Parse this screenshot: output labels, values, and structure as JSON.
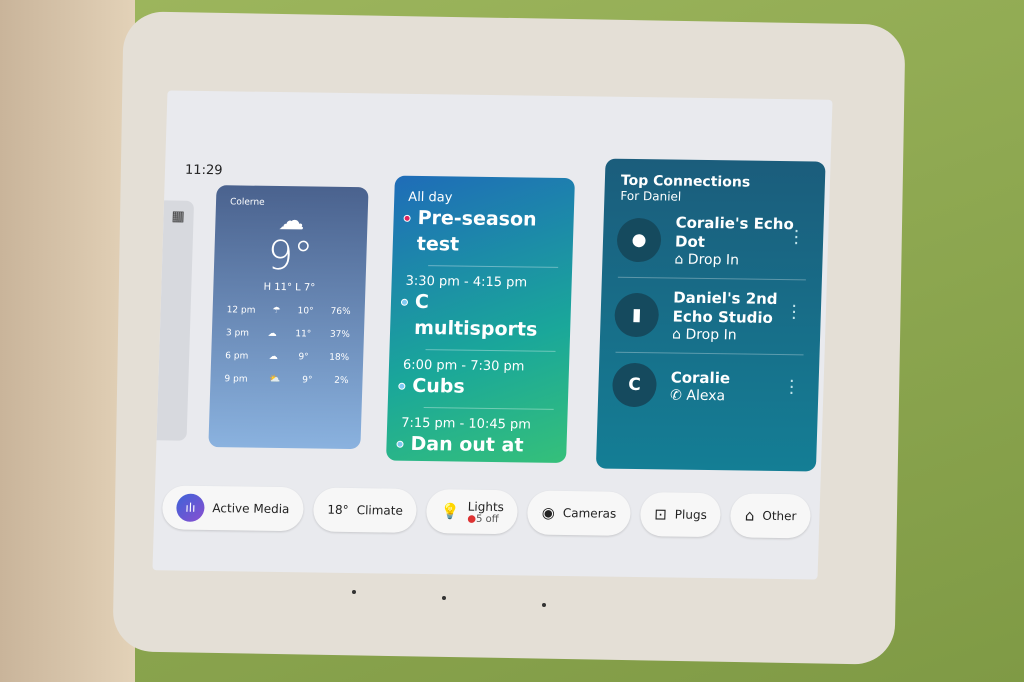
{
  "status": {
    "time": "11:29"
  },
  "weather": {
    "location": "Colerne",
    "temp": "9°",
    "high_low": "H 11°  L 7°",
    "hourly": [
      {
        "time": "12 pm",
        "icon": "rain-icon",
        "temp": "10°",
        "precip": "76%"
      },
      {
        "time": "3 pm",
        "icon": "cloud-icon",
        "temp": "11°",
        "precip": "37%"
      },
      {
        "time": "6 pm",
        "icon": "cloud-icon",
        "temp": "9°",
        "precip": "18%"
      },
      {
        "time": "9 pm",
        "icon": "partly-cloudy-icon",
        "temp": "9°",
        "precip": "2%"
      }
    ]
  },
  "calendar": {
    "events": [
      {
        "time": "All day",
        "title": "Pre-season test",
        "color": "#e0245e"
      },
      {
        "time": "3:30 pm - 4:15 pm",
        "title": "C multisports",
        "color": "#7ec8f0"
      },
      {
        "time": "6:00 pm - 7:30 pm",
        "title": "Cubs",
        "color": "#7ec8f0"
      },
      {
        "time": "7:15 pm - 10:45 pm",
        "title": "Dan out at dinner in Bath",
        "color": "#7ec8f0"
      }
    ]
  },
  "connections": {
    "title": "Top Connections",
    "subtitle": "For Daniel",
    "items": [
      {
        "avatar": "●",
        "name": "Coralie's Echo Dot",
        "action": "Drop In"
      },
      {
        "avatar": "▮",
        "name": "Daniel's 2nd Echo Studio",
        "action": "Drop In"
      },
      {
        "avatar": "C",
        "name": "Coralie",
        "action": "Alexa"
      }
    ]
  },
  "shortcuts": [
    {
      "label": "Active Media",
      "icon": "media-bars-icon"
    },
    {
      "prefix": "18°",
      "label": "Climate"
    },
    {
      "label": "Lights",
      "sub": "5 off",
      "icon": "bulb-icon"
    },
    {
      "label": "Cameras",
      "icon": "camera-icon"
    },
    {
      "label": "Plugs",
      "icon": "plug-icon"
    },
    {
      "label": "Other",
      "icon": "home-icon"
    }
  ]
}
